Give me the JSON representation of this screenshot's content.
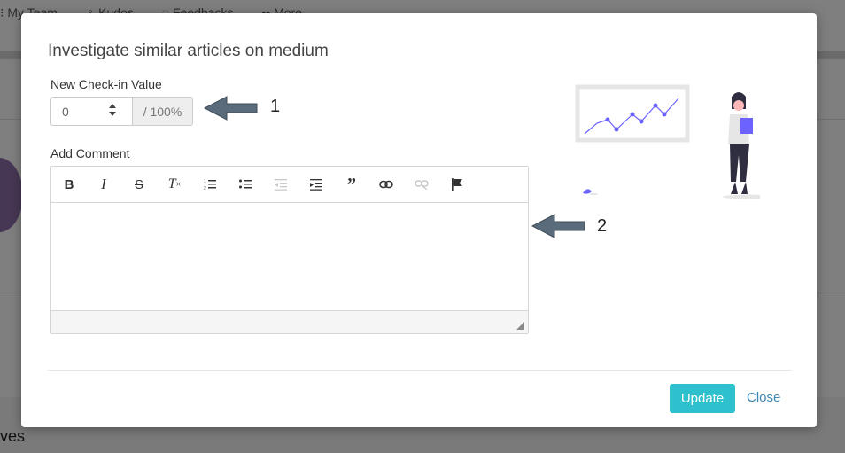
{
  "background": {
    "nav_items": [
      "My Team",
      "Kudos",
      "Feedbacks",
      "More"
    ],
    "partial_heading": "ves"
  },
  "modal": {
    "title": "Investigate similar articles on medium",
    "checkin": {
      "label": "New Check-in Value",
      "value": "0",
      "suffix": "/ 100%"
    },
    "comment": {
      "label": "Add Comment",
      "toolbar": [
        "bold",
        "italic",
        "strikethrough",
        "clear-formatting",
        "ordered-list",
        "bullet-list",
        "outdent",
        "indent",
        "blockquote",
        "link",
        "unlink",
        "flag"
      ]
    },
    "annotations": [
      "1",
      "2"
    ],
    "buttons": {
      "update": "Update",
      "close": "Close"
    }
  },
  "colors": {
    "primary": "#2ec0cc",
    "link": "#3a87b5",
    "accent_purple": "#6c63ff",
    "arrow": "#5a6b7b"
  }
}
